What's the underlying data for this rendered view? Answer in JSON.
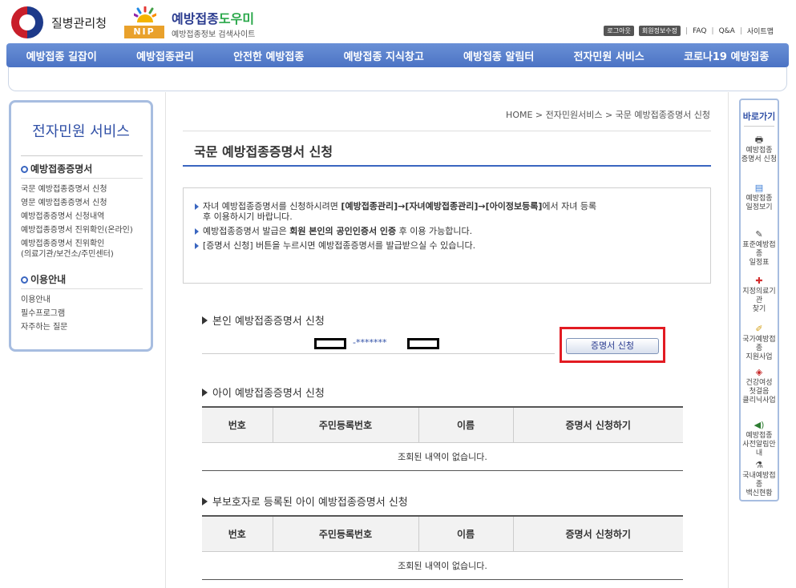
{
  "header": {
    "agency_name": "질병관리청",
    "nip_badge": "NIP",
    "site_name_prefix": "예방접종",
    "site_name_suffix": "도우미",
    "site_subtitle": "예방접종정보 검색사이트",
    "util": {
      "logout": "로그아웃",
      "member_edit": "회원정보수정",
      "faq": "FAQ",
      "qna": "Q&A",
      "sitemap": "사이트맵"
    }
  },
  "nav": [
    "예방접종 길잡이",
    "예방접종관리",
    "안전한 예방접종",
    "예방접종 지식창고",
    "예방접종 알림터",
    "전자민원 서비스",
    "코로나19 예방접종"
  ],
  "sidebar": {
    "title": "전자민원 서비스",
    "section1": "예방접종증명서",
    "section1_items": [
      "국문 예방접종증명서 신청",
      "영문 예방접종증명서 신청",
      "예방접종증명서 신청내역",
      "예방접종증명서 진위확인(온라인)",
      "예방접종증명서 진위확인",
      "(의료기관/보건소/주민센터)"
    ],
    "section2": "이용안내",
    "section2_items": [
      "이용안내",
      "필수프로그램",
      "자주하는 질문"
    ]
  },
  "quick": {
    "title": "바로가기",
    "items": [
      {
        "line1": "예방접종",
        "line2": "증명서 신청",
        "icon": "printer-icon",
        "glyph": "🖶"
      },
      {
        "line1": "예방접종",
        "line2": "일정보기",
        "icon": "calendar-icon",
        "glyph": "▤"
      },
      {
        "line1": "표준예방접종",
        "line2": "일정표",
        "icon": "syringe-icon",
        "glyph": "✎"
      },
      {
        "line1": "지정의료기관",
        "line2": "찾기",
        "icon": "hospital-icon",
        "glyph": "✚"
      },
      {
        "line1": "국가예방접종",
        "line2": "지원사업",
        "icon": "document-icon",
        "glyph": "✐"
      },
      {
        "line1": "건강여성",
        "line2": "첫걸음",
        "line3": "클리닉사업",
        "icon": "box-icon",
        "glyph": "◈"
      },
      {
        "line1": "예방접종",
        "line2": "사전알림안내",
        "icon": "speaker-icon",
        "glyph": "◀)"
      },
      {
        "line1": "국내예방접종",
        "line2": "백신현황",
        "icon": "vial-icon",
        "glyph": "⚗"
      }
    ]
  },
  "breadcrumb": "HOME > 전자민원서비스 > 국문 예방접종증명서 신청",
  "page_title": "국문 예방접종증명서 신청",
  "notice": {
    "line1_pre": "자녀 예방접종증명서를 신청하시려면 ",
    "line1_bold": "[예방접종관리]→[자녀예방접종관리]→[아이정보등록]",
    "line1_post": "에서 자녀 등록",
    "line1_cont": "후 이용하시기 바랍니다.",
    "line2_pre": "예방접종증명서 발급은 ",
    "line2_bold": "회원 본인의 공인인증서 인증",
    "line2_post": " 후 이용 가능합니다.",
    "line3": "[증명서 신청] 버튼을 누르시면 예방접종증명서를 발급받으실 수 있습니다."
  },
  "self_section": {
    "title": "본인 예방접종증명서 신청",
    "masked_id": "-*******",
    "button": "증명서 신청"
  },
  "child_section": {
    "title": "아이 예방접종증명서 신청"
  },
  "guardian_section": {
    "title": "부보호자로 등록된 아이 예방접종증명서 신청"
  },
  "table": {
    "headers": [
      "번호",
      "주민등록번호",
      "이름",
      "증명서 신청하기"
    ],
    "empty": "조회된 내역이 없습니다."
  }
}
